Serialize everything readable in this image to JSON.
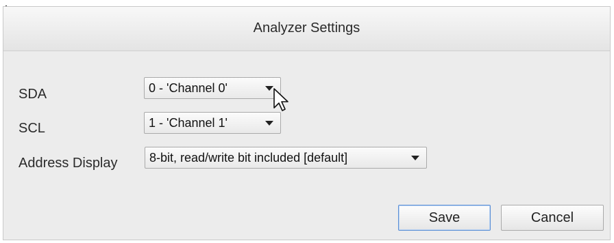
{
  "dialog": {
    "title": "Analyzer Settings",
    "fields": [
      {
        "label": "SDA",
        "value": "0 - 'Channel 0'"
      },
      {
        "label": "SCL",
        "value": "1 - 'Channel 1'"
      },
      {
        "label": "Address Display",
        "value": "8-bit, read/write bit included [default]"
      }
    ],
    "buttons": {
      "save": "Save",
      "cancel": "Cancel"
    }
  },
  "icons": {
    "dropdown": "chevron-down-icon",
    "cursor": "mouse-pointer-icon"
  }
}
